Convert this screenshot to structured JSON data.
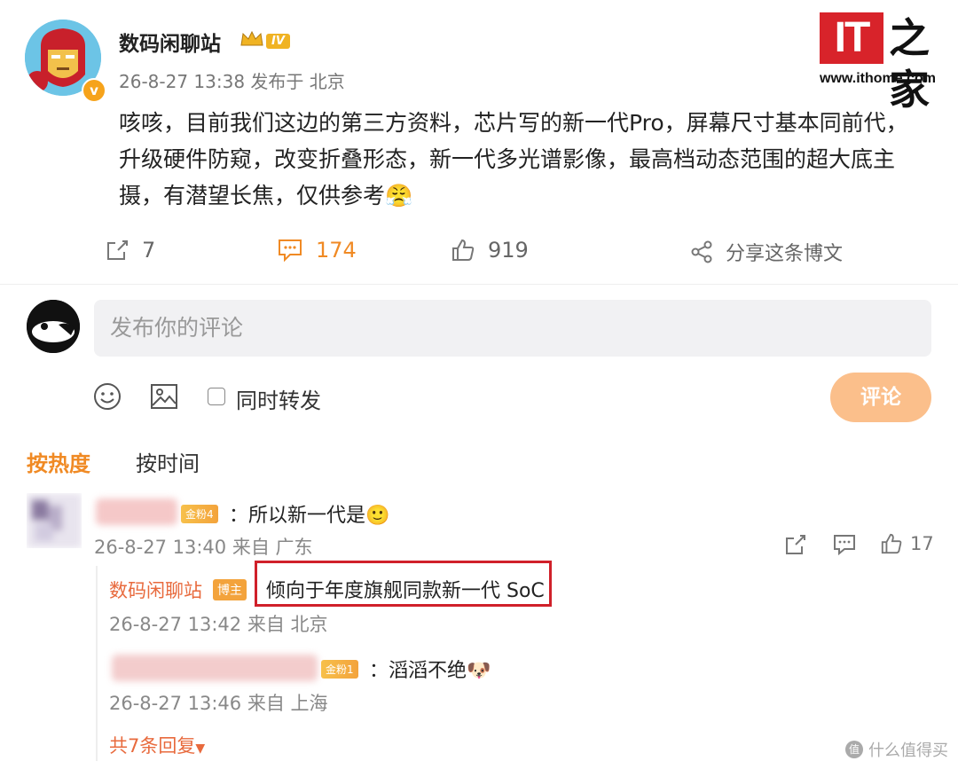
{
  "post": {
    "author": "数码闲聊站",
    "level_badge": "IV",
    "meta": "26-8-27 13:38 发布于 北京",
    "verified_badge": "v",
    "content": "咳咳，目前我们这边的第三方资料，芯片写的新一代Pro，屏幕尺寸基本同前代，升级硬件防窥，改变折叠形态，新一代多光谱影像，最高档动态范围的超大底主摄，有潜望长焦，仅供参考😤",
    "repost_count": "7",
    "comment_count": "174",
    "like_count": "919",
    "share_label": "分享这条博文"
  },
  "logo": {
    "it": "IT",
    "cn": "之家",
    "url": "www.ithome.com"
  },
  "composer": {
    "placeholder": "发布你的评论",
    "repost_label": "同时转发",
    "submit_label": "评论"
  },
  "sort": {
    "hot": "按热度",
    "time": "按时间"
  },
  "comments": [
    {
      "fan_badge": "金粉4",
      "text": "：所以新一代是🙂",
      "meta": "26-8-27 13:40 来自 广东",
      "like_count": "17",
      "replies": [
        {
          "author": "数码闲聊站",
          "host_badge": "博主",
          "text": "倾向于年度旗舰同款新一代 SoC",
          "meta": "26-8-27 13:42 来自 北京"
        },
        {
          "fan_badge": "金粉1",
          "text": "：滔滔不绝🐶",
          "meta": "26-8-27 13:46 来自 上海"
        }
      ],
      "more_replies": "共7条回复"
    }
  ],
  "watermark": "什么值得买",
  "colors": {
    "accent": "#f08a24",
    "highlight_border": "#d0202a",
    "submit_bg": "#fbbf8b",
    "logo_red": "#d8232a"
  }
}
